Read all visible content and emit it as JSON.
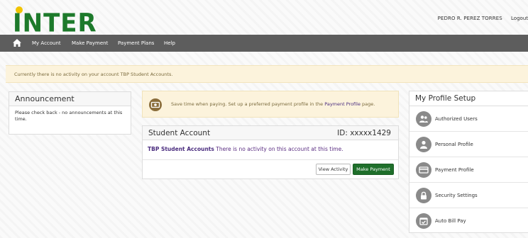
{
  "header": {
    "logo_text": "INTER",
    "user_name": "PEDRO R. PEREZ TORRES",
    "logout_label": "Logout"
  },
  "nav": {
    "items": [
      {
        "label": "My Account"
      },
      {
        "label": "Make Payment"
      },
      {
        "label": "Payment Plans"
      },
      {
        "label": "Help"
      }
    ]
  },
  "notice": {
    "text": "Currently there is no activity on your account TBP Student Accounts."
  },
  "announcement": {
    "title": "Announcement",
    "body": "Please check back - no announcements at this time."
  },
  "tip": {
    "text_before": "Save time when paying. Set up a preferred payment profile in the",
    "link": "Payment Profile",
    "text_after": "page."
  },
  "account": {
    "title": "Student Account",
    "id_label": "ID: xxxxx1429",
    "name": "TBP Student Accounts",
    "message": "There is no activity on this account at this time.",
    "view_activity_label": "View Activity",
    "make_payment_label": "Make Payment"
  },
  "profile_setup": {
    "title": "My Profile Setup",
    "items": [
      {
        "label": "Authorized Users",
        "icon": "users-icon"
      },
      {
        "label": "Personal Profile",
        "icon": "person-icon"
      },
      {
        "label": "Payment Profile",
        "icon": "credit-card-icon"
      },
      {
        "label": "Security Settings",
        "icon": "lock-icon"
      },
      {
        "label": "Auto Bill Pay",
        "icon": "calendar-check-icon"
      }
    ]
  },
  "colors": {
    "brand_green": "#1d7a2b",
    "brand_yellow": "#f1c400",
    "nav_bg": "#5d5d5d",
    "accent_purple": "#4b2d7f",
    "notice_bg": "#fcf3dc",
    "pay_button": "#1f6f2b"
  }
}
